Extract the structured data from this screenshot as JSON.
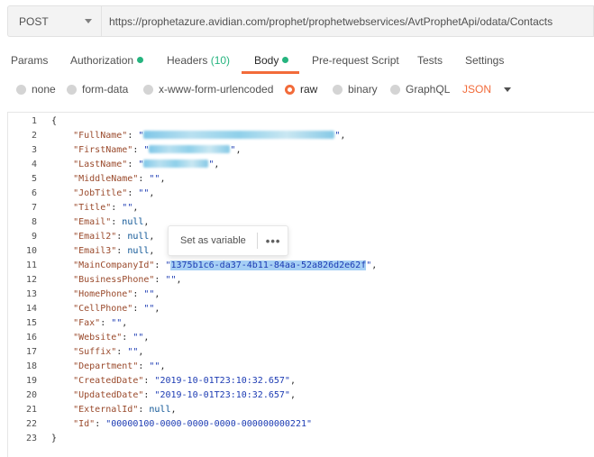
{
  "request": {
    "method": "POST",
    "url": "https://prophetazure.avidian.com/prophet/prophetwebservices/AvtProphetApi/odata/Contacts"
  },
  "tabs": [
    {
      "label": "Params"
    },
    {
      "label": "Authorization"
    },
    {
      "label": "Headers",
      "count": "(10)"
    },
    {
      "label": "Body"
    },
    {
      "label": "Pre-request Script"
    },
    {
      "label": "Tests"
    },
    {
      "label": "Settings"
    }
  ],
  "body_options": {
    "none": "none",
    "form_data": "form-data",
    "urlencoded": "x-www-form-urlencoded",
    "raw": "raw",
    "binary": "binary",
    "graphql": "GraphQL",
    "format": "JSON"
  },
  "tooltip": {
    "label": "Set as variable",
    "more": "•••"
  },
  "colors": {
    "accent": "#f26b3a",
    "status_green": "#26b47f",
    "selection": "#a6d0f5"
  },
  "editor": {
    "line_numbers": [
      "1",
      "2",
      "3",
      "4",
      "5",
      "6",
      "7",
      "8",
      "9",
      "10",
      "11",
      "12",
      "13",
      "14",
      "15",
      "16",
      "17",
      "18",
      "19",
      "20",
      "21",
      "22",
      "23"
    ],
    "lines": {
      "l1": "{",
      "l2_key": "\"FullName\"",
      "l3_key": "\"FirstName\"",
      "l4_key": "\"LastName\"",
      "l5_key": "\"MiddleName\"",
      "l5_val": "\"\"",
      "l6_key": "\"JobTitle\"",
      "l6_val": "\"\"",
      "l7_key": "\"Title\"",
      "l7_val": "\"\"",
      "l8_key": "\"Email\"",
      "l8_val": "null",
      "l9_key": "\"Email2\"",
      "l9_val": "null",
      "l10_key": "\"Email3\"",
      "l10_val": "null",
      "l11_key": "\"MainCompanyId\"",
      "l11_val_sel": "1375b1c6-da37-4b11-84aa-52a826d2e62f",
      "l12_key": "\"BusinessPhone\"",
      "l12_val": "\"\"",
      "l13_key": "\"HomePhone\"",
      "l13_val": "\"\"",
      "l14_key": "\"CellPhone\"",
      "l14_val": "\"\"",
      "l15_key": "\"Fax\"",
      "l15_val": "\"\"",
      "l16_key": "\"Website\"",
      "l16_val": "\"\"",
      "l17_key": "\"Suffix\"",
      "l17_val": "\"\"",
      "l18_key": "\"Department\"",
      "l18_val": "\"\"",
      "l19_key": "\"CreatedDate\"",
      "l19_val": "\"2019-10-01T23:10:32.657\"",
      "l20_key": "\"UpdatedDate\"",
      "l20_val": "\"2019-10-01T23:10:32.657\"",
      "l21_key": "\"ExternalId\"",
      "l21_val": "null",
      "l22_key": "\"Id\"",
      "l22_val": "\"00000100-0000-0000-0000-000000000221\"",
      "l23": "}"
    }
  }
}
